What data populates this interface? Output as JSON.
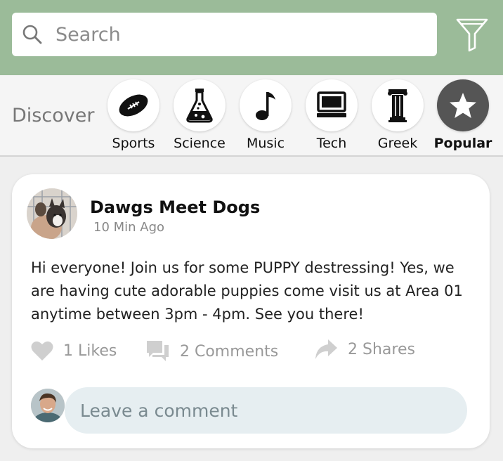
{
  "search": {
    "placeholder": "Search",
    "icon": "search-icon"
  },
  "filter": {
    "icon": "filter-icon"
  },
  "discover": {
    "label": "Discover",
    "categories": [
      {
        "label": "Sports",
        "icon": "football-icon",
        "active": false
      },
      {
        "label": "Science",
        "icon": "flask-icon",
        "active": false
      },
      {
        "label": "Music",
        "icon": "music-note-icon",
        "active": false
      },
      {
        "label": "Tech",
        "icon": "computer-icon",
        "active": false
      },
      {
        "label": "Greek",
        "icon": "greek-column-icon",
        "active": false
      },
      {
        "label": "Popular",
        "icon": "star-icon",
        "active": true
      }
    ]
  },
  "post": {
    "title": "Dawgs Meet Dogs",
    "time": "10 Min Ago",
    "body": "Hi everyone! Join us for some PUPPY destressing!  Yes, we are having cute adorable puppies come visit us at Area 01 anytime between 3pm - 4pm. See you there!",
    "likes": "1 Likes",
    "comments": "2 Comments",
    "shares": "2 Shares"
  },
  "comment": {
    "placeholder": "Leave a comment"
  },
  "colors": {
    "header": "#9bbb99",
    "active_category": "#555555",
    "comment_box": "#e6eef1"
  }
}
